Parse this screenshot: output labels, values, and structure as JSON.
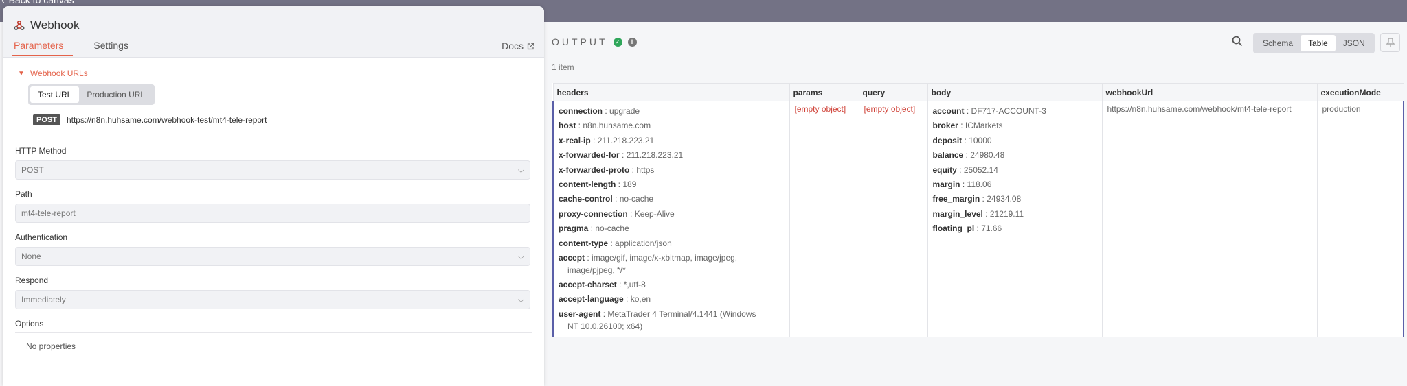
{
  "topbar": {
    "back_label": "Back to canvas"
  },
  "node": {
    "title": "Webhook",
    "tabs": [
      {
        "label": "Parameters"
      },
      {
        "label": "Settings"
      }
    ],
    "docs_label": "Docs"
  },
  "params": {
    "webhook_urls_label": "Webhook URLs",
    "url_modes": [
      {
        "label": "Test URL"
      },
      {
        "label": "Production URL"
      }
    ],
    "method_badge": "POST",
    "url": "https://n8n.huhsame.com/webhook-test/mt4-tele-report",
    "http_method": {
      "label": "HTTP Method",
      "value": "POST"
    },
    "path": {
      "label": "Path",
      "value": "mt4-tele-report"
    },
    "authentication": {
      "label": "Authentication",
      "value": "None"
    },
    "respond": {
      "label": "Respond",
      "value": "Immediately"
    },
    "options_label": "Options",
    "no_properties": "No properties"
  },
  "output": {
    "title": "OUTPUT",
    "item_count": "1 item",
    "views": [
      {
        "label": "Schema"
      },
      {
        "label": "Table"
      },
      {
        "label": "JSON"
      }
    ],
    "columns": [
      "headers",
      "params",
      "query",
      "body",
      "webhookUrl",
      "executionMode"
    ],
    "headers": [
      {
        "k": "connection",
        "v": "upgrade"
      },
      {
        "k": "host",
        "v": "n8n.huhsame.com"
      },
      {
        "k": "x-real-ip",
        "v": "211.218.223.21"
      },
      {
        "k": "x-forwarded-for",
        "v": "211.218.223.21"
      },
      {
        "k": "x-forwarded-proto",
        "v": "https"
      },
      {
        "k": "content-length",
        "v": "189"
      },
      {
        "k": "cache-control",
        "v": "no-cache"
      },
      {
        "k": "proxy-connection",
        "v": "Keep-Alive"
      },
      {
        "k": "pragma",
        "v": "no-cache"
      },
      {
        "k": "content-type",
        "v": "application/json"
      },
      {
        "k": "accept",
        "v": "image/gif, image/x-xbitmap, image/jpeg,",
        "v2": "image/pjpeg, */*"
      },
      {
        "k": "accept-charset",
        "v": "*,utf-8"
      },
      {
        "k": "accept-language",
        "v": "ko,en"
      },
      {
        "k": "user-agent",
        "v": "MetaTrader 4 Terminal/4.1441 (Windows",
        "v2": "NT 10.0.26100; x64)"
      }
    ],
    "params_value": "[empty object]",
    "query_value": "[empty object]",
    "body": [
      {
        "k": "account",
        "v": "DF717-ACCOUNT-3"
      },
      {
        "k": "broker",
        "v": "ICMarkets"
      },
      {
        "k": "deposit",
        "v": "10000"
      },
      {
        "k": "balance",
        "v": "24980.48"
      },
      {
        "k": "equity",
        "v": "25052.14"
      },
      {
        "k": "margin",
        "v": "118.06"
      },
      {
        "k": "free_margin",
        "v": "24934.08"
      },
      {
        "k": "margin_level",
        "v": "21219.11"
      },
      {
        "k": "floating_pl",
        "v": "71.66"
      }
    ],
    "webhook_url": "https://n8n.huhsame.com/webhook/mt4-tele-report",
    "execution_mode": "production"
  },
  "colors": {
    "accent": "#e4634b",
    "success": "#2fa65a",
    "topbar": "#737285",
    "row_marker": "#5a5fa8",
    "empty": "#d0443a"
  }
}
